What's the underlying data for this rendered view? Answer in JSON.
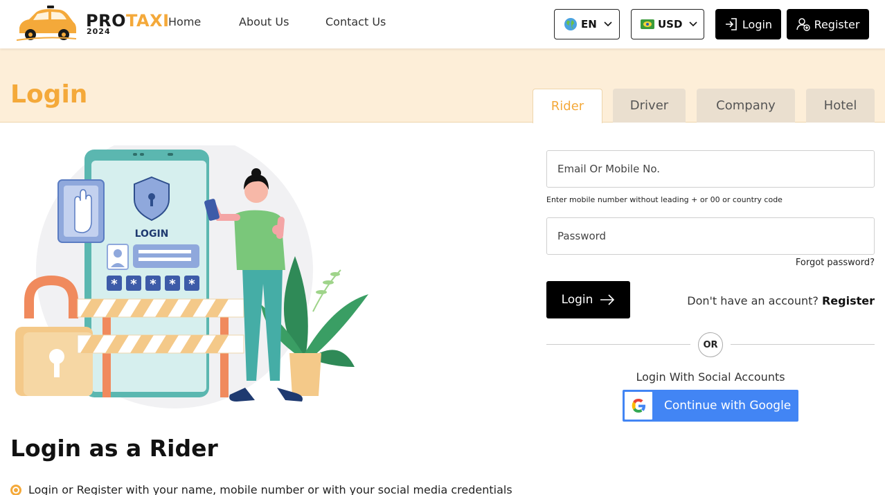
{
  "header": {
    "logo_pro": "PRO",
    "logo_taxi": "TAXI",
    "logo_year": "2024",
    "nav": {
      "home": "Home",
      "about": "About Us",
      "contact": "Contact Us"
    },
    "language": "EN",
    "currency": "USD",
    "login_label": "Login",
    "register_label": "Register"
  },
  "banner": {
    "title": "Login",
    "tabs": {
      "rider": "Rider",
      "driver": "Driver",
      "company": "Company",
      "hotel": "Hotel"
    },
    "active_tab": "Rider"
  },
  "form": {
    "email_placeholder": "Email Or Mobile No.",
    "email_hint": "Enter mobile number without leading + or 00 or country code",
    "password_placeholder": "Password",
    "forgot_label": "Forgot password?",
    "submit_label": "Login",
    "no_account_text": "Don't have an account?",
    "register_link": "Register",
    "or_label": "OR",
    "social_text": "Login With Social Accounts",
    "google_label": "Continue with Google"
  },
  "illustration": {
    "screen_label": "LOGIN"
  },
  "section": {
    "title": "Login as a Rider",
    "bullets": [
      "Login or Register with your name, mobile number  or with your social media credentials"
    ]
  },
  "colors": {
    "accent": "#f4a93a",
    "banner": "#fdeed8",
    "google": "#4285f4"
  }
}
